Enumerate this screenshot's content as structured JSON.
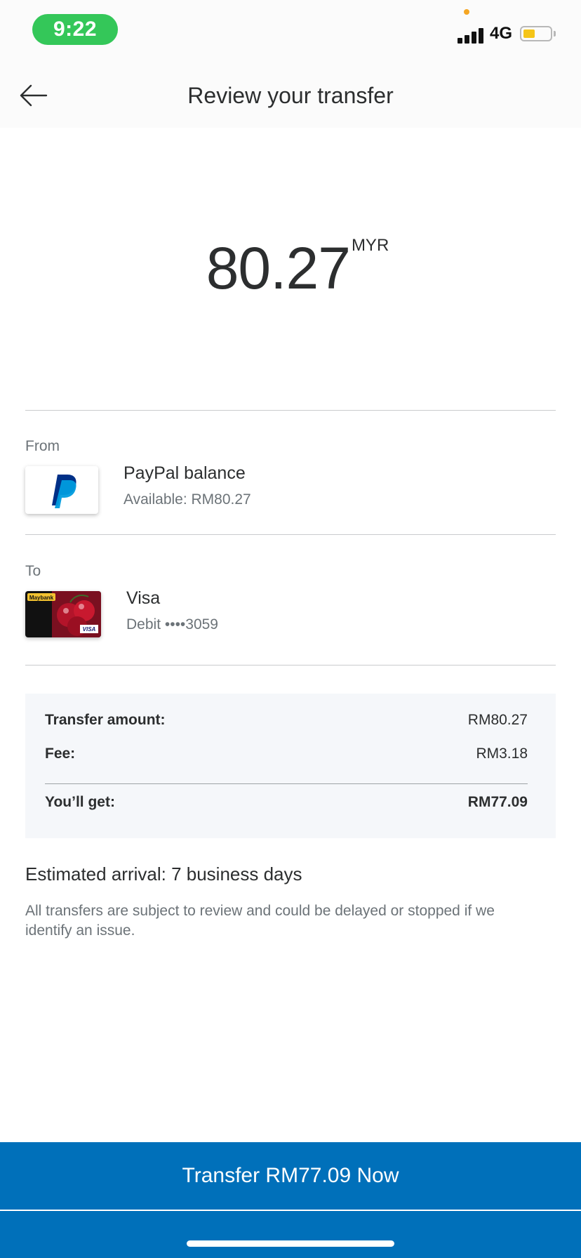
{
  "status_bar": {
    "time": "9:22",
    "network": "4G",
    "icons": [
      "signal-icon",
      "battery-icon"
    ]
  },
  "header": {
    "title": "Review your transfer",
    "back_icon": "arrow-left-icon"
  },
  "amount": {
    "value": "80.27",
    "currency": "MYR"
  },
  "from": {
    "label": "From",
    "name": "PayPal balance",
    "detail": "Available: RM80.27",
    "icon": "paypal-logo-icon"
  },
  "to": {
    "label": "To",
    "name": "Visa",
    "detail": "Debit ••••3059",
    "card_bank": "Maybank",
    "card_network": "VISA"
  },
  "summary": {
    "rows": [
      {
        "label": "Transfer amount:",
        "value": "RM80.27"
      },
      {
        "label": "Fee:",
        "value": "RM3.18"
      }
    ],
    "total": {
      "label": "You’ll get:",
      "value": "RM77.09"
    }
  },
  "eta": "Estimated arrival: 7 business days",
  "disclaimer": "All transfers are subject to review and could be delayed or stopped if we identify an issue.",
  "cta": {
    "label": "Transfer RM77.09 Now"
  },
  "colors": {
    "primary": "#0070ba",
    "status_pill": "#34c759",
    "battery": "#f5c518",
    "summary_bg": "#f5f7fa"
  }
}
